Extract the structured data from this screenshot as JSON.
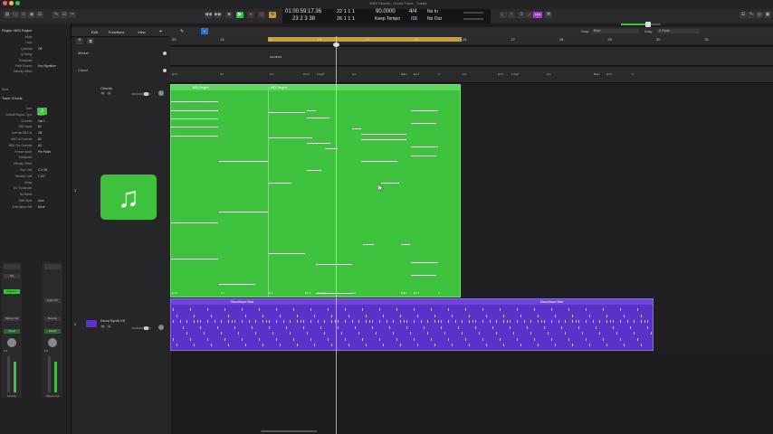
{
  "window": {
    "title": "MIDI Chords - Chord Track - Tracks",
    "close_color": "#ff5f57",
    "minimize_color": "#febc2e",
    "zoom_color": "#28c840"
  },
  "lcd": {
    "time": "01:00:59:17.36",
    "bar_position": "23 2 3   38",
    "bar_small": "22 1 1     1",
    "bar_small2": "26 1 1     1",
    "tempo": "90.0000",
    "signature": "4/4",
    "division": "/16",
    "key": "Keep Tempo",
    "midi_in": "No In",
    "midi_out": "No Out"
  },
  "transport": {
    "rewind_icon": "rewind-icon",
    "forward_icon": "forward-icon",
    "stop_icon": "stop-icon",
    "play_icon": "play-icon",
    "record_icon": "record-icon",
    "cycle_icon": "cycle-icon",
    "play_color": "#28c840",
    "record_color": "#ff453a",
    "cycle_color": "#c9a227",
    "badge": "1234"
  },
  "toolbar": {
    "edit": "Edit",
    "functions": "Functions",
    "view": "View",
    "snap_label": "Snap:",
    "snap_value": "Beat",
    "drag_label": "Drag:",
    "drag_value": "X-Fade"
  },
  "inspector": {
    "region_header": "Region: MIDI Region",
    "region_rows": [
      {
        "k": "Mute:",
        "v": ""
      },
      {
        "k": "Loop:",
        "v": ""
      },
      {
        "k": "Quantize",
        "v": "Off"
      },
      {
        "k": "Q-Swing:",
        "v": ""
      },
      {
        "k": "Transpose:",
        "v": ""
      },
      {
        "k": "Pitch Source:",
        "v": "Key Signature"
      },
      {
        "k": "Velocity Offset:",
        "v": ""
      }
    ],
    "more": "More",
    "track_header": "Track: Chords",
    "track_rows": [
      {
        "k": "Icon:",
        "v": ""
      },
      {
        "k": "Default Region Type:",
        "v": "MIDI"
      },
      {
        "k": "Channel:",
        "v": "Inst 1"
      },
      {
        "k": "MIDI Input:",
        "v": "All"
      },
      {
        "k": "Internal MIDI In:",
        "v": "Off"
      },
      {
        "k": "MIDI In Channel:",
        "v": "All"
      },
      {
        "k": "MIDI Out Channel:",
        "v": "All"
      },
      {
        "k": "Freeze Mode:",
        "v": "Pre Fader"
      },
      {
        "k": "Transpose:",
        "v": ""
      },
      {
        "k": "Velocity Offset:",
        "v": ""
      },
      {
        "k": "Key Limit:",
        "v": "C-2  G8"
      },
      {
        "k": "Velocity Limit:",
        "v": "1  127"
      },
      {
        "k": "Delay:",
        "v": ""
      },
      {
        "k": "No Transpose:",
        "v": ""
      },
      {
        "k": "No Reset:",
        "v": ""
      },
      {
        "k": "Staff Style:",
        "v": "Auto"
      },
      {
        "k": "Articulation Set:",
        "v": "None"
      }
    ],
    "strip_left": {
      "name": "Chords",
      "send": "Output 1",
      "plugin1": "EQ",
      "plugin2": "Stereo Out",
      "read": "Read",
      "pan_value": "0.0",
      "bottom_label": "Chords"
    },
    "strip_right": {
      "name": "Stereo Out",
      "plugin1": "Audio FX",
      "plugin2": "Bounce",
      "read": "Read",
      "pan_value": "0.0",
      "bottom_label": "Stereo Out"
    }
  },
  "ruler": {
    "bars": [
      "20",
      "21",
      "22",
      "23",
      "24",
      "25",
      "26",
      "27",
      "28",
      "29",
      "30",
      "31"
    ]
  },
  "global_tracks": {
    "marker_label": "Marker",
    "chord_label": "Chord",
    "marker_text": "CHORUS",
    "chords": [
      "Em7",
      "G7",
      "Am",
      "Dm7",
      "Fmaj7",
      "Am",
      "Bdim",
      "Em7",
      "C",
      "Am",
      "Em7",
      "Fmaj7",
      "Am",
      "Bdim",
      "Em7",
      "C"
    ]
  },
  "tracks": [
    {
      "number": "1",
      "name": "Chords",
      "region_color": "#3ec23e",
      "regions": [
        {
          "name": "MIDI Region"
        },
        {
          "name": "MIDI Region"
        }
      ],
      "bottom_chords": [
        "Em7",
        "G7",
        "Am",
        "Dm7",
        "Fmaj7",
        "Am",
        "Bdim",
        "Em7",
        "C"
      ],
      "icon": "music-note-icon"
    },
    {
      "number": "2",
      "name": "Drum Synth Kit",
      "region_color": "#5b32c9",
      "regions": [
        {
          "name": "Discotheque Beat"
        },
        {
          "name": "Discotheque Beat"
        }
      ]
    }
  ],
  "track_buttons": {
    "mute": "M",
    "solo": "S"
  }
}
